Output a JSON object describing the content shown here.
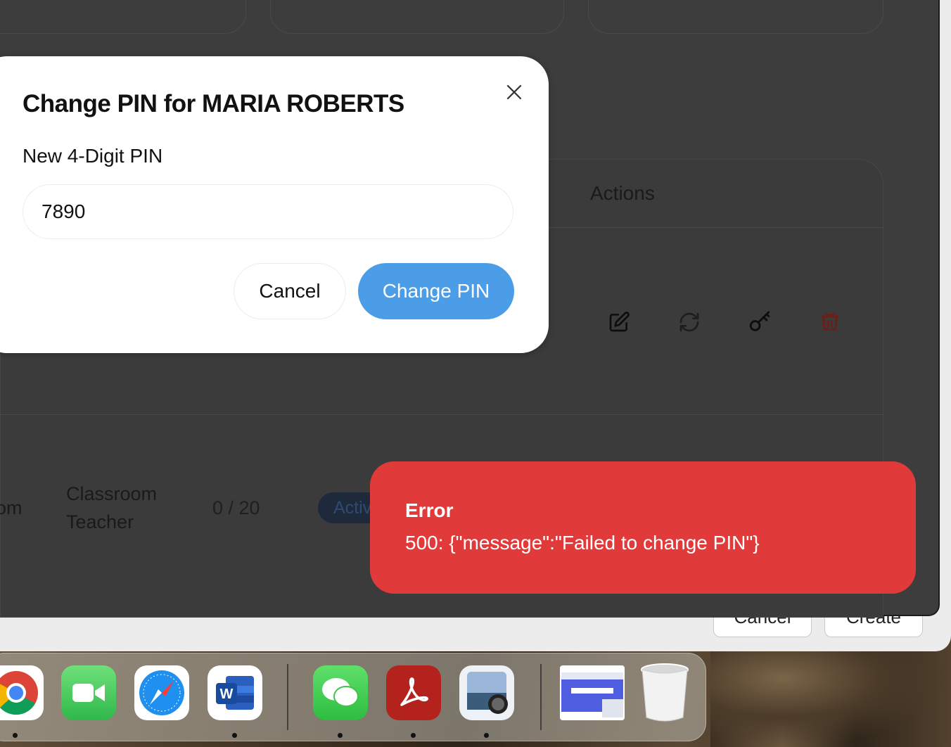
{
  "modal": {
    "title": "Change PIN for MARIA ROBERTS",
    "field_label": "New 4-Digit PIN",
    "pin_value": "7890",
    "cancel_label": "Cancel",
    "submit_label": "Change PIN"
  },
  "table": {
    "actions_header": "Actions",
    "row": {
      "name_fragment": "om",
      "role_line1": "Classroom",
      "role_line2": "Teacher",
      "capacity": "0 / 20",
      "status": "Active"
    },
    "row_actions": [
      "edit-icon",
      "refresh-icon",
      "key-icon",
      "trash-icon"
    ]
  },
  "toast": {
    "title": "Error",
    "message": "500: {\"message\":\"Failed to change PIN\"}",
    "color": "#e03a3a"
  },
  "back_window": {
    "cancel_label": "Cancel",
    "create_label": "Create"
  },
  "dock": {
    "apps": [
      "Chrome",
      "FaceTime",
      "Safari",
      "Word",
      "WeChat",
      "Acrobat",
      "Preview",
      "Document thumbnail",
      "Trash"
    ]
  },
  "colors": {
    "accent": "#4c9de8",
    "error": "#e03a3a",
    "delete": "#c0392b"
  }
}
